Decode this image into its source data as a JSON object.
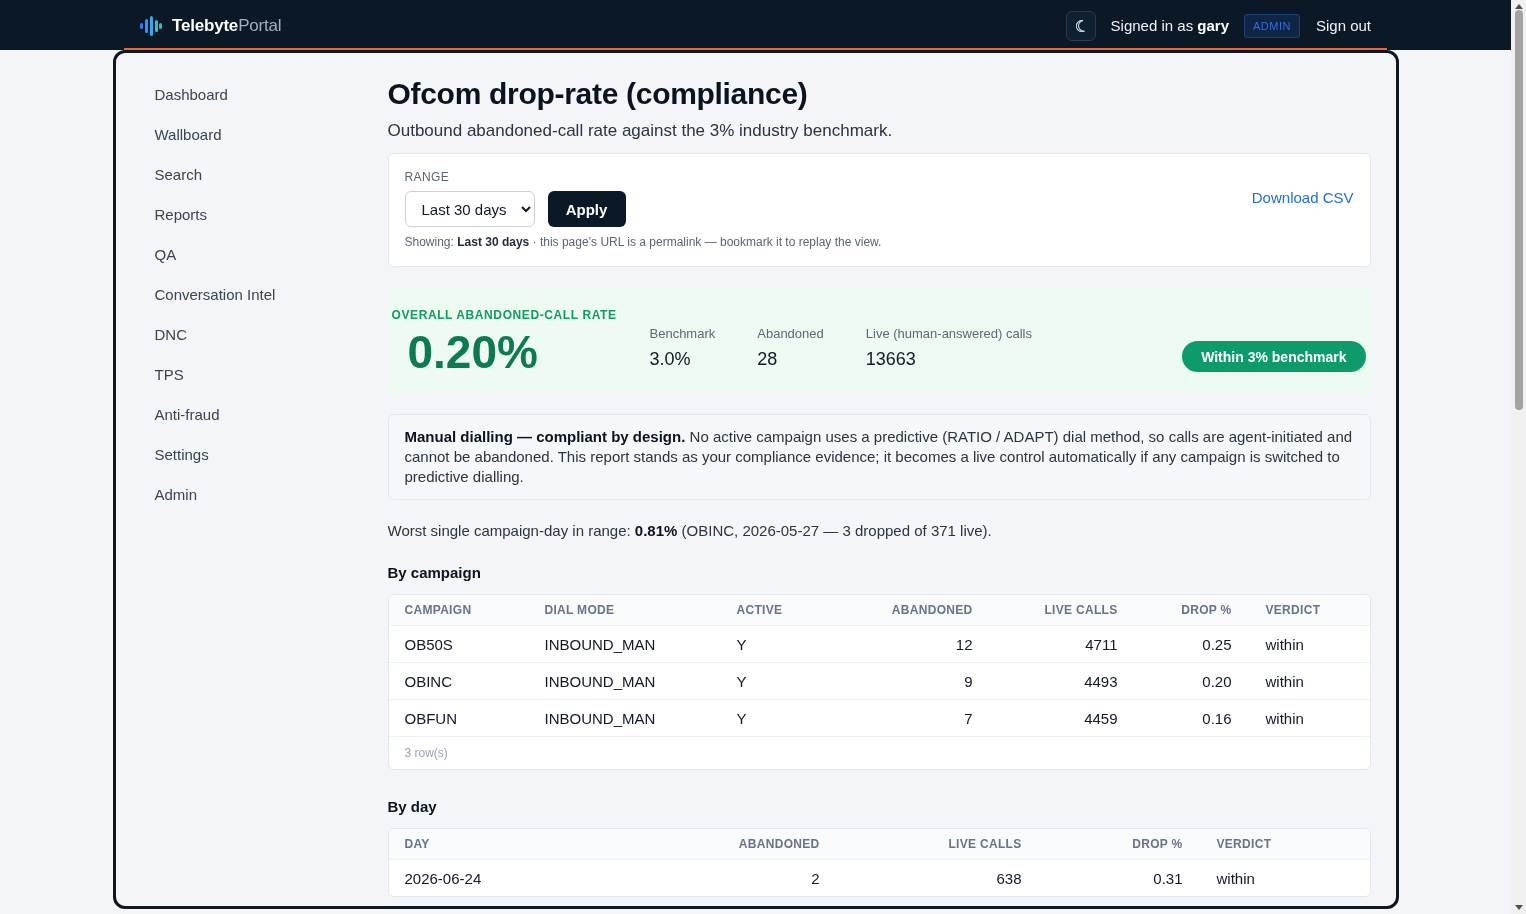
{
  "header": {
    "brand": {
      "name": "Telebyte",
      "suffix": "Portal"
    },
    "user": "Signed in as **gary**",
    "role_badge": "ADMIN",
    "sign_out": "Sign out"
  },
  "sidebar": {
    "items": [
      "Dashboard",
      "Wallboard",
      "Search",
      "Reports",
      "QA",
      "Conversation Intel",
      "DNC",
      "TPS",
      "Anti-fraud",
      "Settings",
      "Admin"
    ]
  },
  "page": {
    "title": "Ofcom drop-rate (compliance)",
    "subtitle": "Outbound abandoned-call rate against the 3% industry benchmark."
  },
  "range_card": {
    "label": "RANGE",
    "select_value": "Last 30 days",
    "apply_button": "Apply",
    "download_link": "Download CSV",
    "note": "Showing: **Last 30 days** · this page’s URL is a permalink — bookmark it to replay the view."
  },
  "summary": {
    "within_benchmark": true,
    "label": "OVERALL ABANDONED-CALL RATE",
    "rate": "0.20%",
    "stats": [
      {
        "label": "Benchmark",
        "value": "3.0%"
      },
      {
        "label": "Abandoned",
        "value": "28"
      },
      {
        "label": "Live (human-answered) calls",
        "value": "13663"
      }
    ],
    "verdict_badge": "Within 3% benchmark"
  },
  "notice": "**Manual dialling — compliant by design.** No active campaign uses a predictive (RATIO / ADAPT) dial method, so calls are agent-initiated and cannot be abandoned. This report stands as your compliance evidence; it becomes a live control automatically if any campaign is switched to predictive dialling.",
  "worst_day": "Worst single campaign-day in range: **0.81%** (OBINC, 2026-05-27 — 3 dropped of 371 live).",
  "tables": [
    {
      "title": "By campaign",
      "columns": [
        {
          "label": "CAMPAIGN",
          "kind": "text"
        },
        {
          "label": "DIAL MODE",
          "kind": "text"
        },
        {
          "label": "ACTIVE",
          "kind": "text"
        },
        {
          "label": "ABANDONED",
          "kind": "number"
        },
        {
          "label": "LIVE CALLS",
          "kind": "number"
        },
        {
          "label": "DROP %",
          "kind": "number"
        },
        {
          "label": "VERDICT",
          "kind": "text"
        }
      ],
      "rows": [
        [
          "OB50S",
          "INBOUND_MAN",
          "Y",
          "12",
          "4711",
          "0.25",
          "within"
        ],
        [
          "OBINC",
          "INBOUND_MAN",
          "Y",
          "9",
          "4493",
          "0.20",
          "within"
        ],
        [
          "OBFUN",
          "INBOUND_MAN",
          "Y",
          "7",
          "4459",
          "0.16",
          "within"
        ]
      ],
      "footer": "3 row(s)"
    },
    {
      "title": "By day",
      "columns": [
        {
          "label": "DAY",
          "kind": "text"
        },
        {
          "label": "ABANDONED",
          "kind": "number"
        },
        {
          "label": "LIVE CALLS",
          "kind": "number"
        },
        {
          "label": "DROP %",
          "kind": "number"
        },
        {
          "label": "VERDICT",
          "kind": "text"
        }
      ],
      "rows": [
        [
          "2026-06-24",
          "2",
          "638",
          "0.31",
          "within"
        ]
      ]
    }
  ]
}
